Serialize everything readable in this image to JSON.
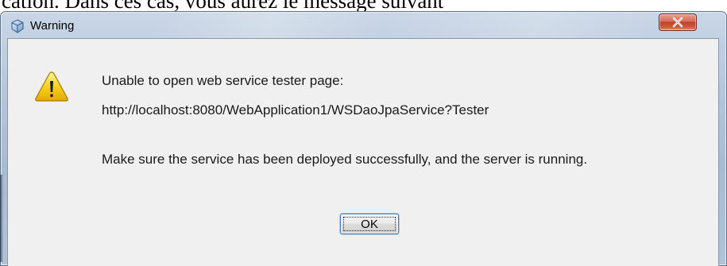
{
  "document": {
    "partial_text": "cation. Dans ces cas, vous aurez le message suivant"
  },
  "window": {
    "title": "Warning",
    "title_icon": "java-cup-icon",
    "close_icon": "close-icon"
  },
  "dialog": {
    "icon": "warning-triangle-icon",
    "line1": "Unable to open web service tester page:",
    "line2": "http://localhost:8080/WebApplication1/WSDaoJpaService?Tester",
    "line3": "Make sure the service has been deployed successfully, and the server is running.",
    "ok_label": "OK"
  },
  "colors": {
    "close_button": "#c9502f",
    "warning_yellow": "#f5c400",
    "client_bg": "#f0f0f0",
    "focus_border": "#3c7fb1"
  }
}
